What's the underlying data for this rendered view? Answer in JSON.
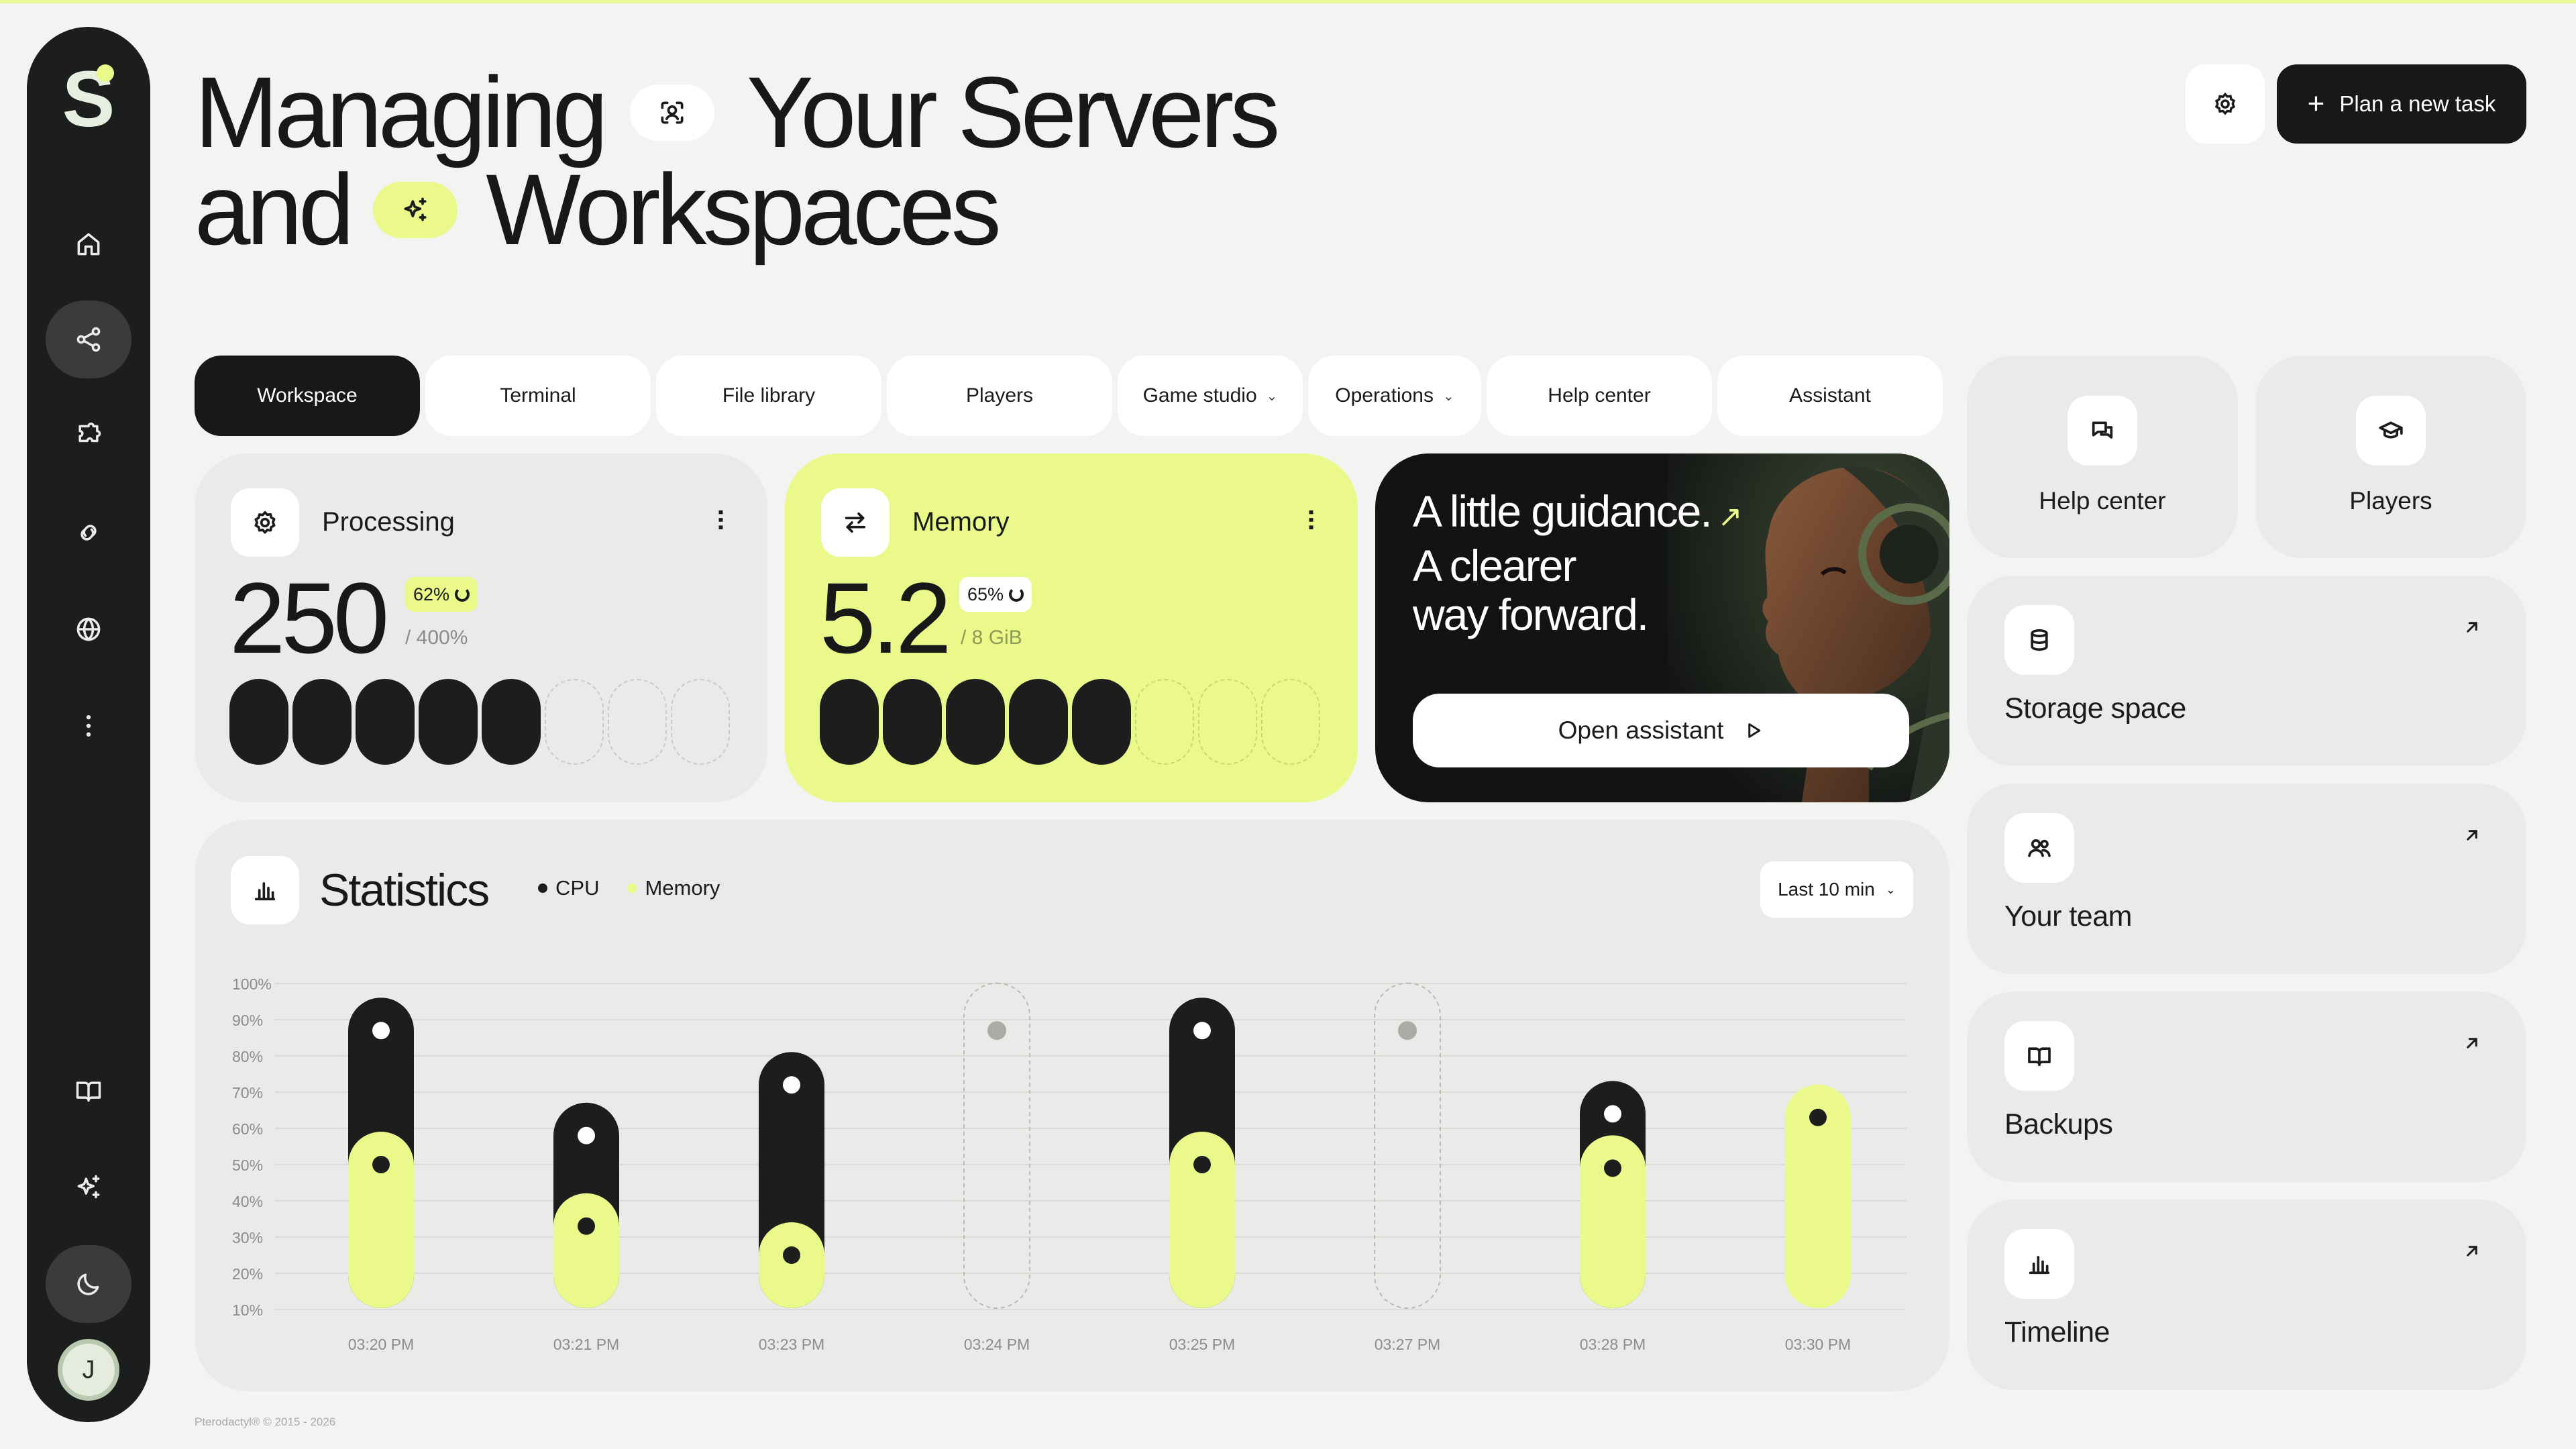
{
  "header": {
    "title_line1_a": "Managing",
    "title_line1_b": "Your Servers",
    "title_line2_a": "and",
    "title_line2_b": "Workspaces",
    "plan_button": "Plan a new task"
  },
  "sidebar": {
    "logo": "S",
    "avatar_initial": "J",
    "items": [
      "home-icon",
      "share-icon",
      "puzzle-icon",
      "link-icon",
      "globe-icon",
      "more-vertical-icon",
      "book-icon",
      "sparkle-icon",
      "moon-icon"
    ]
  },
  "tabs": [
    {
      "label": "Workspace",
      "active": true
    },
    {
      "label": "Terminal"
    },
    {
      "label": "File library"
    },
    {
      "label": "Players"
    },
    {
      "label": "Game studio",
      "dropdown": true
    },
    {
      "label": "Operations",
      "dropdown": true
    },
    {
      "label": "Help center"
    },
    {
      "label": "Assistant"
    }
  ],
  "processing": {
    "title": "Processing",
    "value": "250",
    "badge": "62%",
    "limit": "/ 400%",
    "filled_segments": 5,
    "total_segments": 8
  },
  "memory": {
    "title": "Memory",
    "value": "5.2",
    "badge": "65%",
    "limit": "/ 8 GiB",
    "filled_segments": 5,
    "total_segments": 8
  },
  "assistant": {
    "line1": "A little guidance.",
    "line2": "A clearer",
    "line3": "way forward.",
    "button": "Open assistant"
  },
  "statistics": {
    "title": "Statistics",
    "legend_cpu": "CPU",
    "legend_memory": "Memory",
    "range": "Last 10 min"
  },
  "chart_data": {
    "type": "bar",
    "title": "Statistics",
    "y_ticks": [
      "100%",
      "90%",
      "80%",
      "70%",
      "60%",
      "50%",
      "40%",
      "30%",
      "20%",
      "10%"
    ],
    "ylim": [
      10,
      100
    ],
    "categories": [
      "03:20 PM",
      "03:21 PM",
      "03:23 PM",
      "03:24 PM",
      "03:25 PM",
      "03:27 PM",
      "03:28 PM",
      "03:30 PM"
    ],
    "series": [
      {
        "name": "CPU",
        "values": [
          87,
          58,
          72,
          null,
          87,
          null,
          64,
          null
        ]
      },
      {
        "name": "Memory",
        "values": [
          50,
          33,
          25,
          null,
          50,
          null,
          49,
          63
        ]
      }
    ],
    "colors": {
      "cpu": "#1c1d1d",
      "memory": "#eaf98a"
    },
    "grid": true
  },
  "right_panel": {
    "help_center": "Help center",
    "players": "Players",
    "links": [
      {
        "label": "Storage space",
        "icon": "database-icon"
      },
      {
        "label": "Your team",
        "icon": "users-icon"
      },
      {
        "label": "Backups",
        "icon": "book-icon"
      },
      {
        "label": "Timeline",
        "icon": "bar-chart-icon"
      }
    ]
  },
  "footer": "Pterodactyl® © 2015 - 2026",
  "colors": {
    "accent": "#eaf98a",
    "dark": "#171818",
    "card": "#e9ebe8",
    "background": "#f3f3f2"
  }
}
